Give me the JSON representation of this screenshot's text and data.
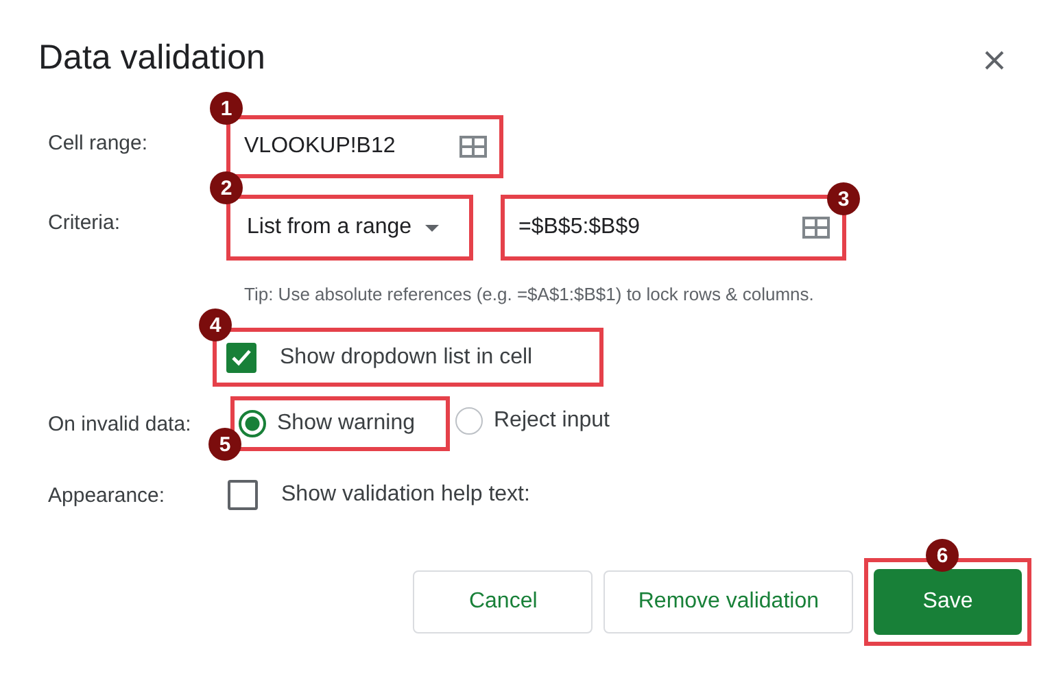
{
  "dialog": {
    "title": "Data validation"
  },
  "cell_range": {
    "label": "Cell range:",
    "value": "VLOOKUP!B12",
    "marker": "1"
  },
  "criteria": {
    "label": "Criteria:",
    "dropdown": {
      "value": "List from a range",
      "marker": "2"
    },
    "range": {
      "value": "=$B$5:$B$9",
      "marker": "3"
    },
    "tip": "Tip: Use absolute references (e.g. =$A$1:$B$1) to lock rows & columns."
  },
  "show_dropdown": {
    "label": "Show dropdown list in cell",
    "checked": true,
    "marker": "4"
  },
  "on_invalid": {
    "label": "On invalid data:",
    "options": [
      {
        "label": "Show warning",
        "selected": true,
        "marker": "5"
      },
      {
        "label": "Reject input",
        "selected": false
      }
    ]
  },
  "appearance": {
    "label": "Appearance:",
    "option": {
      "label": "Show validation help text:",
      "checked": false
    }
  },
  "buttons": [
    {
      "label": "Cancel",
      "kind": "secondary"
    },
    {
      "label": "Remove validation",
      "kind": "secondary"
    },
    {
      "label": "Save",
      "kind": "primary",
      "marker": "6"
    }
  ]
}
